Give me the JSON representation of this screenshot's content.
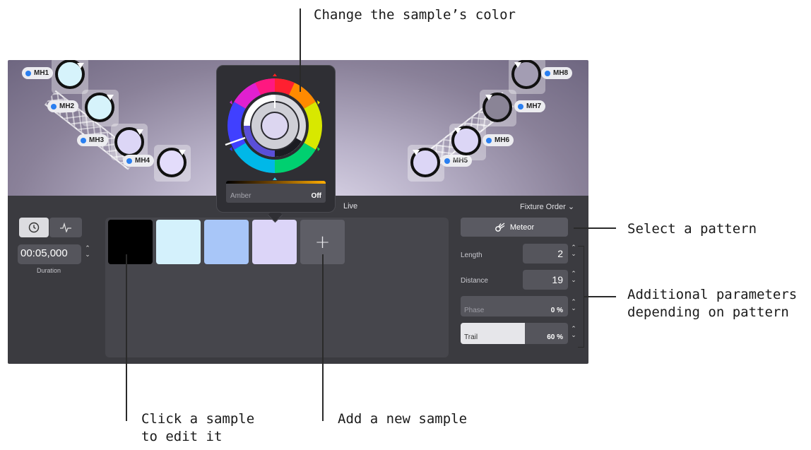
{
  "annotations": {
    "color": "Change the sample’s color",
    "pattern": "Select a pattern",
    "params_line1": "Additional parameters",
    "params_line2": "depending on pattern",
    "click_line1": "Click a sample",
    "click_line2": "to edit it",
    "add": "Add a new sample"
  },
  "fixtures": [
    {
      "label": "MH1",
      "color": "#d6f3fb"
    },
    {
      "label": "MH2",
      "color": "#d6f3fb"
    },
    {
      "label": "MH3",
      "color": "#dcd6f6"
    },
    {
      "label": "MH4",
      "color": "#e3dcfb"
    },
    {
      "label": "MH5",
      "color": "#dcd6f6"
    },
    {
      "label": "MH6",
      "color": "#dcd6f6"
    },
    {
      "label": "MH7",
      "color": "#8a8496"
    },
    {
      "label": "MH8",
      "color": "#a39db3"
    }
  ],
  "color_popover": {
    "amber_label": "Amber",
    "amber_value": "Off",
    "selected_color": "#dcd6f0"
  },
  "header": {
    "live_label": "Live",
    "fixture_order_label": "Fixture Order ⌄"
  },
  "timing": {
    "duration_value": "00:05,000",
    "duration_label": "Duration"
  },
  "samples": [
    {
      "color": "#000000"
    },
    {
      "color": "#d4f1fc"
    },
    {
      "color": "#a8c6f8"
    },
    {
      "color": "#dcd5f8"
    }
  ],
  "add_sample_label": "+",
  "pattern": {
    "name": "Meteor",
    "params": [
      {
        "label": "Length",
        "value": "2"
      },
      {
        "label": "Distance",
        "value": "19"
      },
      {
        "label": "Phase",
        "value": "0 %",
        "fill": 0
      },
      {
        "label": "Trail",
        "value": "60 %",
        "fill": 0.6
      }
    ]
  }
}
